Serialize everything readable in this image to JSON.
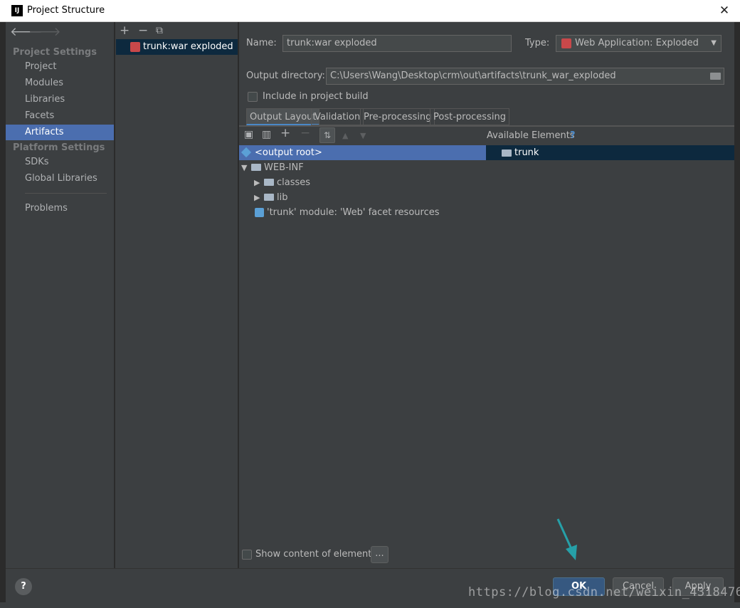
{
  "window": {
    "title": "Project Structure",
    "logo": "IJ",
    "close_glyph": "✕"
  },
  "sidebar": {
    "back": "🡐",
    "forward": "🡒",
    "group1": "Project Settings",
    "items1": [
      "Project",
      "Modules",
      "Libraries",
      "Facets",
      "Artifacts"
    ],
    "group2": "Platform Settings",
    "items2": [
      "SDKs",
      "Global Libraries"
    ],
    "problems": "Problems",
    "selected": "Artifacts"
  },
  "artifact_list": {
    "toolbar": {
      "add": "+",
      "remove": "−",
      "copy": "⧉"
    },
    "items": [
      "trunk:war exploded"
    ]
  },
  "form": {
    "name_label": "Name:",
    "name_value": "trunk:war exploded",
    "type_label": "Type:",
    "type_value": "Web Application: Exploded",
    "output_dir_label": "Output directory:",
    "output_dir_value": "C:\\Users\\Wang\\Desktop\\crm\\out\\artifacts\\trunk_war_exploded",
    "include_build_label": "Include in project build",
    "include_build_checked": false
  },
  "tabs": [
    "Output Layout",
    "Validation",
    "Pre-processing",
    "Post-processing"
  ],
  "active_tab": "Output Layout",
  "layout": {
    "available_label": "Available Elements",
    "help_glyph": "?",
    "tree": {
      "root": "<output root>",
      "web_inf": "WEB-INF",
      "classes": "classes",
      "lib": "lib",
      "facet": "'trunk' module: 'Web' facet resources"
    },
    "available": [
      "trunk"
    ],
    "show_content_label": "Show content of elements",
    "ellipsis": "..."
  },
  "footer": {
    "help": "?",
    "ok": "OK",
    "cancel": "Cancel",
    "apply": "Apply"
  },
  "watermark": "https://blog.csdn.net/weixin_43184769",
  "colors": {
    "accent": "#4b6eaf",
    "panel": "#3c3f41",
    "selection_dark": "#0d293e",
    "arrow": "#26a0a8"
  }
}
